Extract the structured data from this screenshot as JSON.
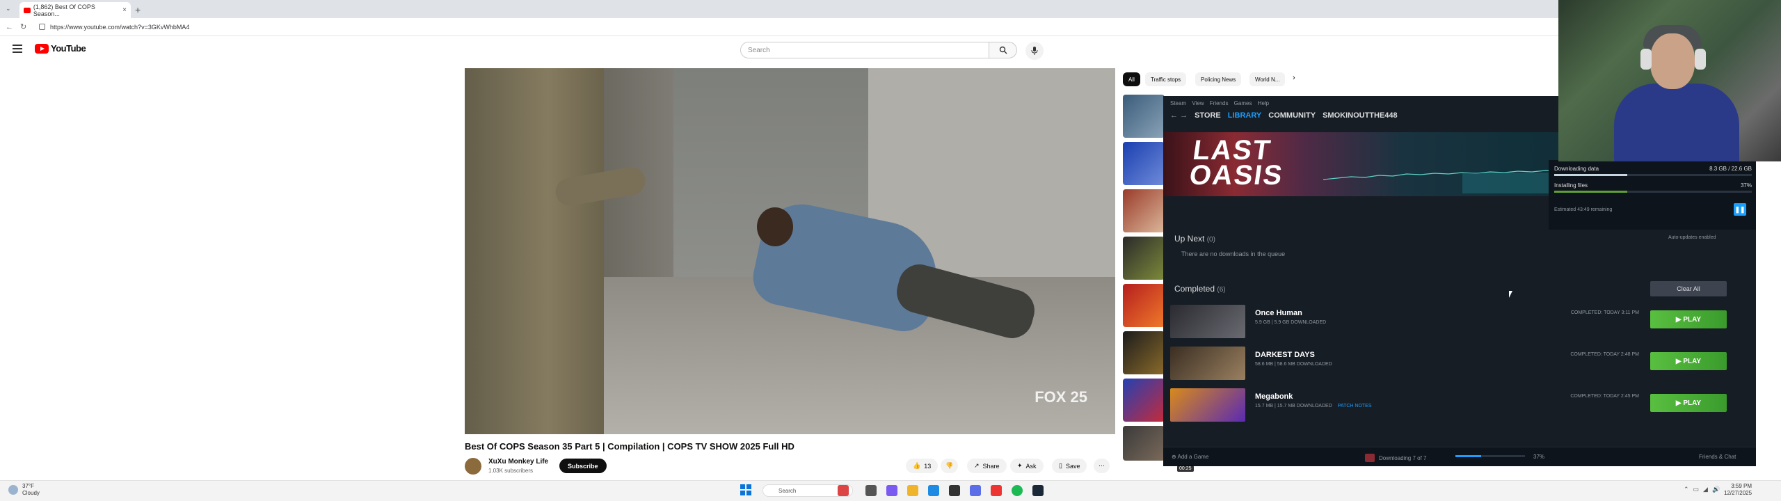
{
  "browser": {
    "tab_title": "(1,862) Best Of COPS Season...",
    "url": "https://www.youtube.com/watch?v=3GKvWhbMA4",
    "new_tab": "+",
    "tab_close": "×"
  },
  "youtube": {
    "logo_text": "YouTube",
    "search_placeholder": "Search",
    "chips": [
      "All",
      "Traffic stops",
      "Policing News",
      "World N..."
    ],
    "video": {
      "title": "Best Of COPS Season 35 Part 5 | Compilation | COPS TV SHOW 2025 Full HD",
      "watermark": "FOX 25",
      "channel": "XuXu Monkey Life",
      "subscribers": "1.03K subscribers",
      "subscribe_label": "Subscribe",
      "likes": "13",
      "share_label": "Share",
      "ask_label": "Ask",
      "save_label": "Save",
      "more_label": "⋯"
    }
  },
  "steam": {
    "menu": "Steam View Friends Games Help",
    "nav": [
      "STORE",
      "LIBRARY",
      "COMMUNITY",
      "SMOKINOUTTHE448"
    ],
    "banner_logo": "LAST OASIS",
    "download": {
      "status1": "Downloading data",
      "amount": "8.3 GB / 22.6 GB",
      "status2": "Installing files",
      "percent": "37%",
      "progress": 0.37,
      "eta": "Estimated 43:49 remaining",
      "pause_icon": "❚❚"
    },
    "up_next": {
      "title": "Up Next",
      "count": "(0)",
      "empty": "There are no downloads in the queue",
      "auto": "Auto-updates enabled"
    },
    "completed": {
      "title": "Completed",
      "count": "(6)",
      "clear_label": "Clear All",
      "games": [
        {
          "name": "Once Human",
          "size": "5.9 GB | 5.9 GB DOWNLOADED",
          "patch": "",
          "done": "COMPLETED: TODAY 3:11 PM",
          "play": "▶ PLAY"
        },
        {
          "name": "DARKEST DAYS",
          "size": "58.6 MB | 58.6 MB DOWNLOADED",
          "patch": "",
          "done": "COMPLETED: TODAY 2:48 PM",
          "play": "▶ PLAY"
        },
        {
          "name": "Megabonk",
          "size": "15.7 MB | 15.7 MB DOWNLOADED",
          "patch": "PATCH NOTES",
          "done": "COMPLETED: TODAY 2:45 PM",
          "play": "▶ PLAY"
        }
      ]
    },
    "bottom": {
      "add_game": "Add a Game",
      "downloading": "Downloading 7 of 7",
      "percent": "37%",
      "friends": "Friends & Chat"
    },
    "video_time": "00:25"
  },
  "taskbar": {
    "weather_temp": "37°F",
    "weather_desc": "Cloudy",
    "search_label": "Search",
    "time": "3:59 PM",
    "date": "12/27/2025"
  },
  "colors": {
    "steam_blue": "#1a9fff",
    "play_green": "#59bf40",
    "youtube_red": "#ff0000"
  }
}
